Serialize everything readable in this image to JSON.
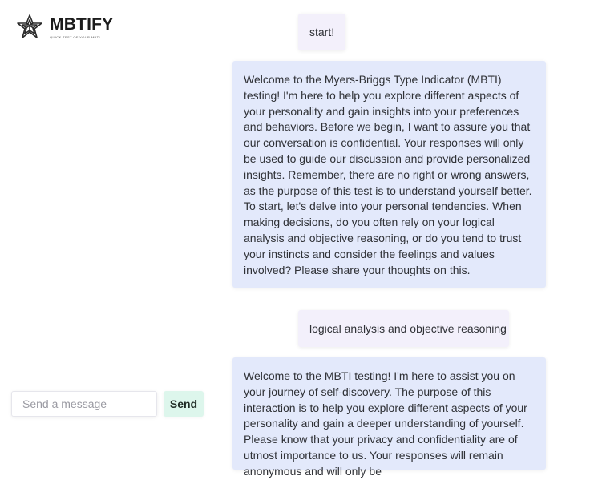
{
  "brand": {
    "name": "MBTIFY",
    "tagline": "QUICK TEST OF YOUR MBTI",
    "logo_icon": "star-knot-icon"
  },
  "composer": {
    "placeholder": "Send a message",
    "send_label": "Send",
    "send_color": "#ddf6ec"
  },
  "colors": {
    "user_bubble": "#f3f0fb",
    "bot_bubble": "#e3e9fb"
  },
  "messages": [
    {
      "role": "user",
      "text": "start!"
    },
    {
      "role": "assistant",
      "text": "Welcome to the Myers-Briggs Type Indicator (MBTI) testing! I'm here to help you explore different aspects of your personality and gain insights into your preferences and behaviors. Before we begin, I want to assure you that our conversation is confidential. Your responses will only be used to guide our discussion and provide personalized insights. Remember, there are no right or wrong answers, as the purpose of this test is to understand yourself better. To start, let's delve into your personal tendencies. When making decisions, do you often rely on your logical analysis and objective reasoning, or do you tend to trust your instincts and consider the feelings and values involved? Please share your thoughts on this."
    },
    {
      "role": "user",
      "text": "logical analysis and objective reasoning"
    },
    {
      "role": "assistant",
      "text": "Welcome to the MBTI testing! I'm here to assist you on your journey of self-discovery. The purpose of this interaction is to help you explore different aspects of your personality and gain a deeper understanding of yourself. Please know that your privacy and confidentiality are of utmost importance to us. Your responses will remain anonymous and will only be"
    }
  ]
}
